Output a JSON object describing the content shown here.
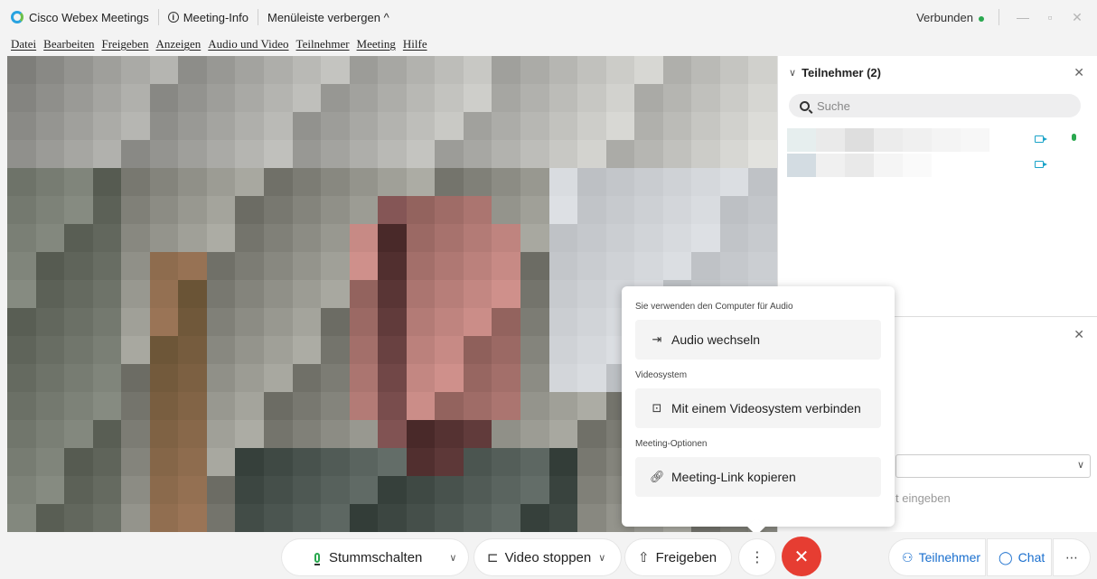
{
  "titlebar": {
    "app_name": "Cisco Webex Meetings",
    "meeting_info": "Meeting-Info",
    "hide_menu": "Menüleiste verbergen ^",
    "status": "Verbunden",
    "status_color": "#2aa84f"
  },
  "menubar": {
    "items": [
      "Datei",
      "Bearbeiten",
      "Freigeben",
      "Anzeigen",
      "Audio und Video",
      "Teilnehmer",
      "Meeting",
      "Hilfe"
    ]
  },
  "panel": {
    "title": "Teilnehmer (2)",
    "search_placeholder": "Suche",
    "chat_input_hint": "t eingeben"
  },
  "popup": {
    "sections": [
      {
        "heading": "Sie verwenden den Computer für Audio",
        "button": "Audio wechseln",
        "icon": "audio-switch-icon"
      },
      {
        "heading": "Videosystem",
        "button": "Mit einem Videosystem verbinden",
        "icon": "cast-icon"
      },
      {
        "heading": "Meeting-Optionen",
        "button": "Meeting-Link kopieren",
        "icon": "link-icon"
      }
    ]
  },
  "controls": {
    "mute": "Stummschalten",
    "video": "Video stoppen",
    "share": "Freigeben",
    "participants": "Teilnehmer",
    "chat": "Chat",
    "end_color": "#e63d32",
    "accent_color": "#1a6fce"
  }
}
